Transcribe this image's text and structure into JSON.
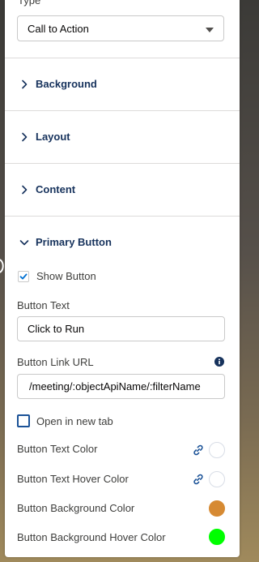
{
  "type_field": {
    "label": "Type",
    "selected": "Call to Action"
  },
  "sections": [
    {
      "title": "Background",
      "expanded": false
    },
    {
      "title": "Layout",
      "expanded": false
    },
    {
      "title": "Content",
      "expanded": false
    },
    {
      "title": "Primary Button",
      "expanded": true
    }
  ],
  "primary_button": {
    "show_button_label": "Show Button",
    "show_button_checked": true,
    "button_text_label": "Button Text",
    "button_text_value": "Click to Run",
    "button_link_label": "Button Link URL",
    "button_link_value": "/meeting/:objectApiName/:filterName",
    "open_new_tab_label": "Open in new tab",
    "open_new_tab_checked": false,
    "colors": [
      {
        "label": "Button Text Color",
        "value": "#ffffff",
        "linked": true
      },
      {
        "label": "Button Text Hover Color",
        "value": "#ffffff",
        "linked": true
      },
      {
        "label": "Button Background Color",
        "value": "#d68a33",
        "linked": false
      },
      {
        "label": "Button Background Hover Color",
        "value": "#00ff00",
        "linked": false
      }
    ]
  },
  "theme": {
    "heading_color": "#16325c",
    "accent": "#0070d2"
  }
}
